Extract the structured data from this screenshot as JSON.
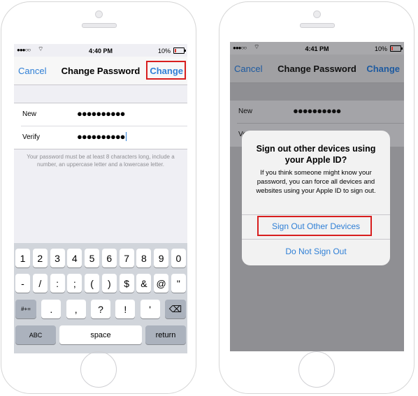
{
  "screen1": {
    "status": {
      "signal": "●●●○○",
      "wifi": "⌔",
      "time": "4:40 PM",
      "battery": "10%"
    },
    "nav": {
      "cancel": "Cancel",
      "title": "Change Password",
      "change": "Change"
    },
    "form": {
      "new_label": "New",
      "new_value": "●●●●●●●●●●",
      "verify_label": "Verify",
      "verify_value": "●●●●●●●●●●"
    },
    "hint": "Your password must be at least 8 characters long, include a number, an uppercase letter and a lowercase letter.",
    "keyboard": {
      "row1": [
        "1",
        "2",
        "3",
        "4",
        "5",
        "6",
        "7",
        "8",
        "9",
        "0"
      ],
      "row2": [
        "-",
        "/",
        ":",
        ";",
        "(",
        ")",
        "$",
        "&",
        "@",
        "\""
      ],
      "row3_left": "#+=",
      "row3": [
        ".",
        ",",
        "?",
        "!",
        "'"
      ],
      "row3_right": "⌫",
      "abc": "ABC",
      "space": "space",
      "return": "return"
    }
  },
  "screen2": {
    "status": {
      "signal": "●●●○○",
      "wifi": "⌔",
      "time": "4:41 PM",
      "battery": "10%"
    },
    "nav": {
      "cancel": "Cancel",
      "title": "Change Password",
      "change": "Change"
    },
    "form": {
      "new_label": "New",
      "new_value": "●●●●●●●●●●",
      "verify_label": "Verify",
      "verify_value": "●●●●●●●●●●"
    },
    "alert": {
      "title": "Sign out other devices using your Apple ID?",
      "message": "If you think someone might know your password, you can force all devices and websites using your Apple ID to sign out.",
      "primary": "Sign Out Other Devices",
      "secondary": "Do Not Sign Out"
    }
  },
  "colors": {
    "accent": "#2f7fd6",
    "highlight": "#d81e1e",
    "keyboard_bg": "#d1d5db"
  }
}
